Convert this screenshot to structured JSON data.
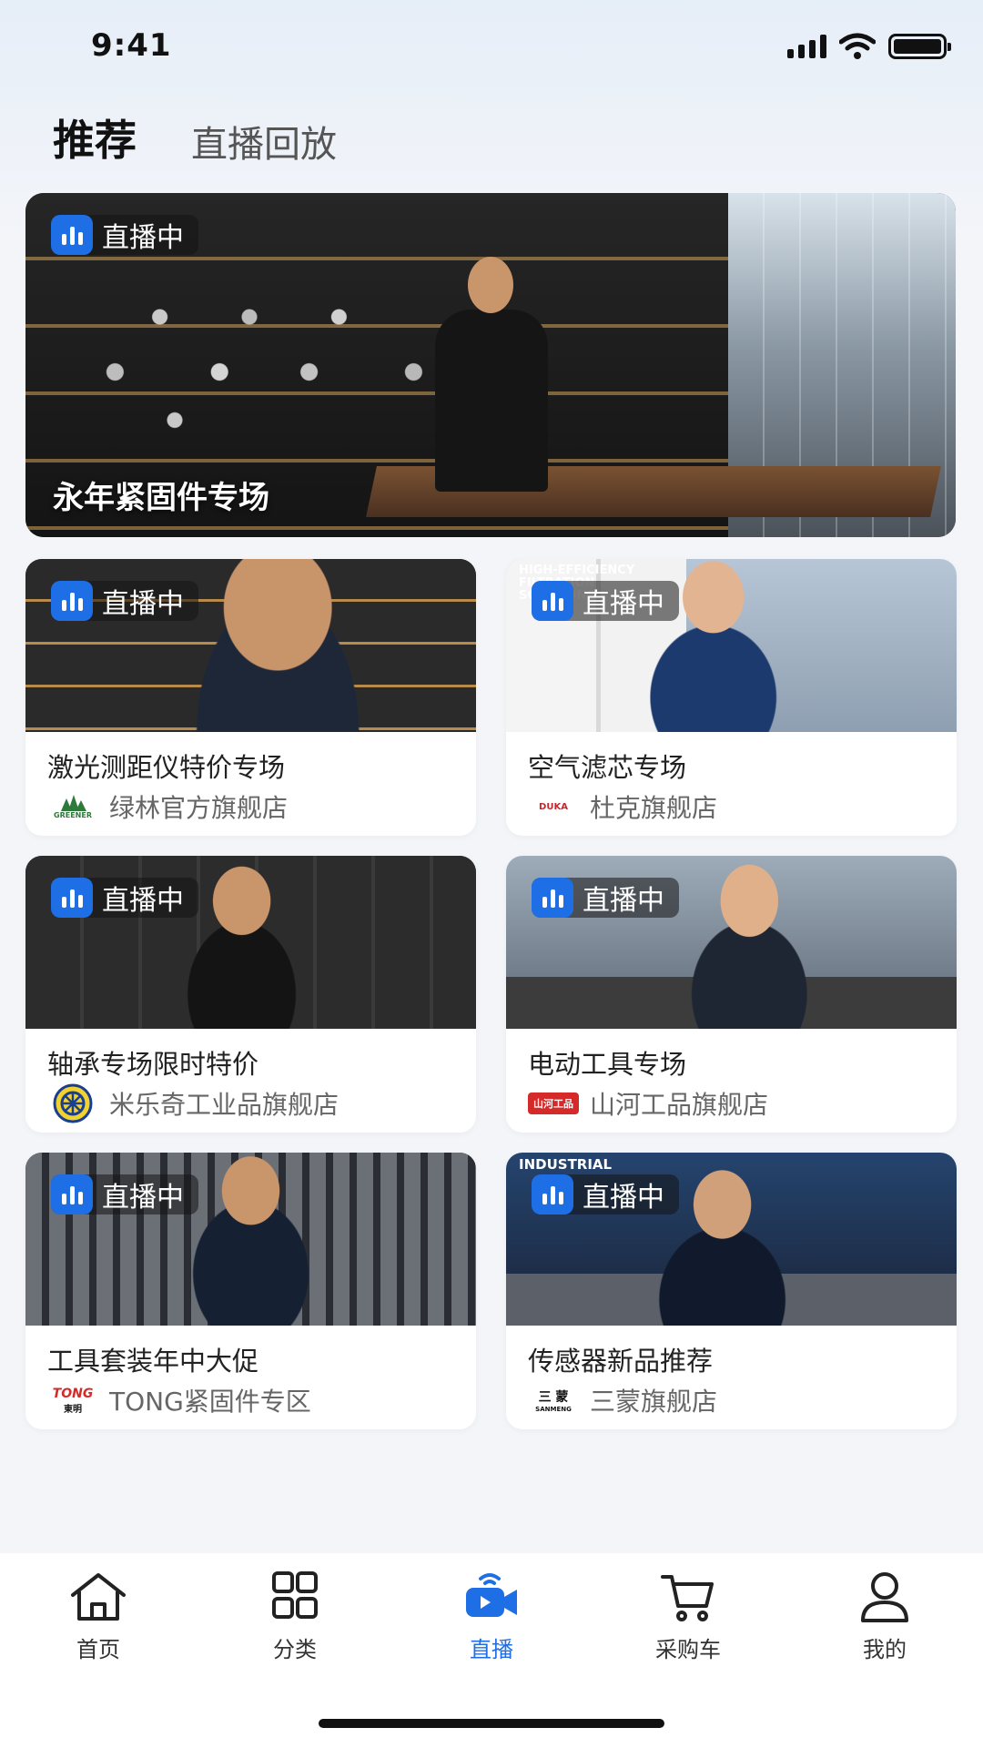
{
  "status_bar": {
    "time": "9:41"
  },
  "tabs": [
    {
      "label": "推荐",
      "active": true
    },
    {
      "label": "直播回放",
      "active": false
    }
  ],
  "live_badge_text": "直播中",
  "hero": {
    "title": "永年紧固件专场"
  },
  "cards": [
    {
      "title": "激光测距仪特价专场",
      "shop": "绿林官方旗舰店",
      "logo_text": "GREENER"
    },
    {
      "title": "空气滤芯专场",
      "shop": "杜克旗舰店",
      "logo_text": "DUKA",
      "image_text": "HIGH-EFFICIENCY FILTRATION SOLUTIONS"
    },
    {
      "title": "轴承专场限时特价",
      "shop": "米乐奇工业品旗舰店",
      "logo_text": ""
    },
    {
      "title": "电动工具专场",
      "shop": "山河工品旗舰店",
      "logo_text": "山河工品"
    },
    {
      "title": "工具套装年中大促",
      "shop": "TONG紧固件专区",
      "logo_text": "TONG"
    },
    {
      "title": "传感器新品推荐",
      "shop": "三蒙旗舰店",
      "logo_text": "SANMENG",
      "image_text": "INDUSTRIAL"
    }
  ],
  "bottom_nav": [
    {
      "label": "首页",
      "icon": "home-icon",
      "active": false
    },
    {
      "label": "分类",
      "icon": "grid-icon",
      "active": false
    },
    {
      "label": "直播",
      "icon": "live-camera-icon",
      "active": true
    },
    {
      "label": "采购车",
      "icon": "cart-icon",
      "active": false
    },
    {
      "label": "我的",
      "icon": "user-icon",
      "active": false
    }
  ],
  "colors": {
    "accent": "#1e6fe6",
    "background": "#f3f5f9"
  }
}
